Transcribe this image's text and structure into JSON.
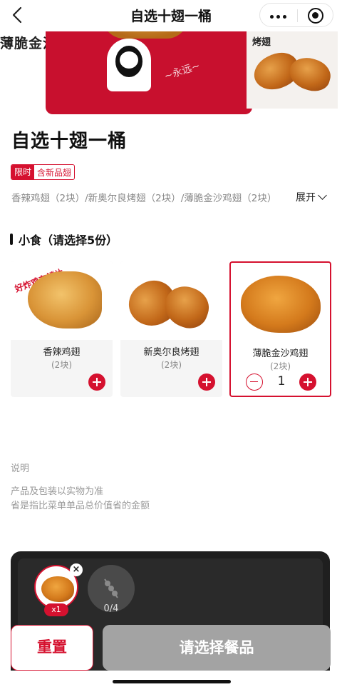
{
  "nav": {
    "title": "自选十翅一桶",
    "back_icon": "chevron-left-icon",
    "more_icon": "more-dots-icon",
    "close_icon": "target-circle-icon"
  },
  "banner": {
    "bucket_label": "薄脆金沙翅",
    "side_label": "烤翅"
  },
  "product": {
    "title": "自选十翅一桶",
    "promo_tag": "限时",
    "promo_text": "含新品翅",
    "contents": "香辣鸡翅（2块）/新奥尔良烤翅（2块）/薄脆金沙鸡翅（2块）",
    "expand_label": "展开"
  },
  "section": {
    "title": "小食（请选择5份）"
  },
  "items": [
    {
      "name": "香辣鸡翅",
      "qty": "(2块)",
      "badge": "好炸鸡有鳞片"
    },
    {
      "name": "新奥尔良烤翅",
      "qty": "(2块)"
    },
    {
      "name": "薄脆金沙鸡翅",
      "qty": "(2块)",
      "count": "1"
    }
  ],
  "notes": {
    "heading": "说明",
    "line1": "产品及包装以实物为准",
    "line2": "省是指比菜单单品总价值省的金额"
  },
  "tray": {
    "selected_badge": "x1",
    "empty_count": "0/4"
  },
  "actions": {
    "reset_label": "重置",
    "choose_label": "请选择餐品"
  },
  "colors": {
    "brand": "#d5112f",
    "disabled": "#a3a3a3"
  }
}
